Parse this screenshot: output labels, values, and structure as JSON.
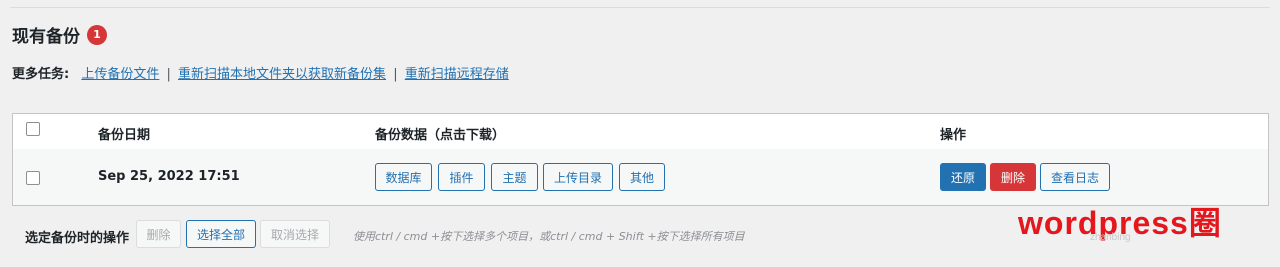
{
  "section": {
    "title": "现有备份",
    "count": "1"
  },
  "tasks": {
    "label": "更多任务:",
    "links": [
      "上传备份文件",
      "重新扫描本地文件夹以获取新备份集",
      "重新扫描远程存储"
    ],
    "separator": "|"
  },
  "table": {
    "headers": {
      "date": "备份日期",
      "data": "备份数据（点击下载）",
      "actions": "操作"
    },
    "rows": [
      {
        "date": "Sep 25, 2022 17:51",
        "data_buttons": [
          "数据库",
          "插件",
          "主题",
          "上传目录",
          "其他"
        ],
        "actions": {
          "restore": "还原",
          "delete": "删除",
          "view_log": "查看日志"
        }
      }
    ]
  },
  "bulk": {
    "label": "选定备份时的操作",
    "delete": "删除",
    "select_all": "选择全部",
    "deselect": "取消选择",
    "hint": "使用ctrl / cmd +按下选择多个项目，或ctrl / cmd + Shift +按下选择所有项目"
  },
  "watermark": {
    "text": "wordpress圈",
    "sub": "zhanbing"
  },
  "colors": {
    "primary": "#2271b1",
    "danger": "#d63638",
    "watermark": "#e4171d"
  }
}
